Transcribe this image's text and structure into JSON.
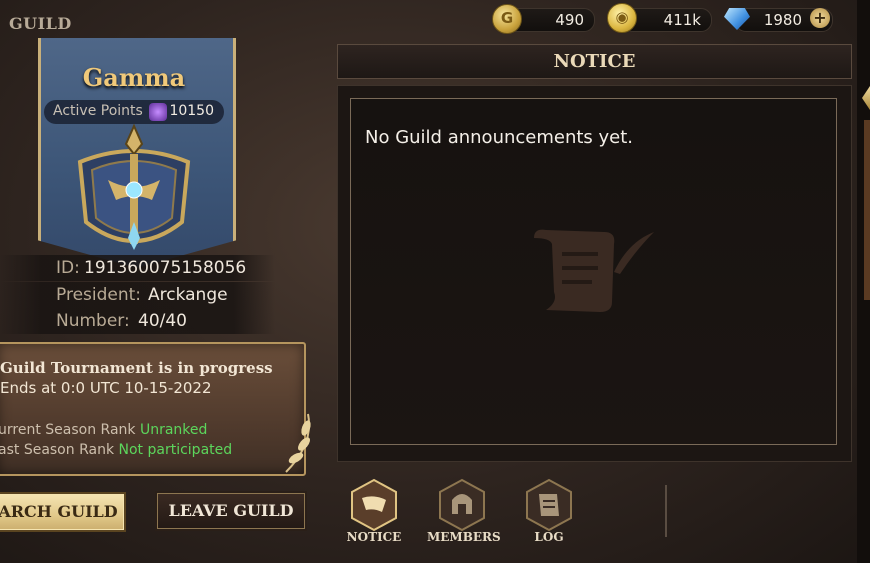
{
  "page": {
    "title": "GUILD"
  },
  "currencies": [
    {
      "name": "gold-coin",
      "value": "490"
    },
    {
      "name": "yellow-coin",
      "value": "411k"
    },
    {
      "name": "diamond",
      "value": "1980"
    }
  ],
  "guild": {
    "name": "Gamma",
    "active_points_label": "Active Points",
    "active_points": "10150",
    "id_label": "ID:",
    "id": "191360075158056",
    "president_label": "President:",
    "president": "Arckange",
    "number_label": "Number:",
    "number": "40/40"
  },
  "tournament": {
    "title": "Guild Tournament is in progress",
    "ends": "Ends at 0:0 UTC 10-15-2022",
    "current_rank_label": "urrent Season Rank",
    "current_rank": "Unranked",
    "last_rank_label": "ast Season Rank",
    "last_rank": "Not participated"
  },
  "buttons": {
    "search_guild": "ARCH GUILD",
    "leave_guild": "LEAVE GUILD"
  },
  "notice": {
    "header": "NOTICE",
    "text": "No Guild announcements yet."
  },
  "tabs": [
    {
      "label": "NOTICE",
      "icon": "horn-icon"
    },
    {
      "label": "MEMBERS",
      "icon": "helmet-icon"
    },
    {
      "label": "LOG",
      "icon": "scroll-icon"
    }
  ],
  "colors": {
    "accent_gold": "#f0c97a",
    "highlight_green": "#5cd65c",
    "banner_blue": "#4f6788"
  }
}
